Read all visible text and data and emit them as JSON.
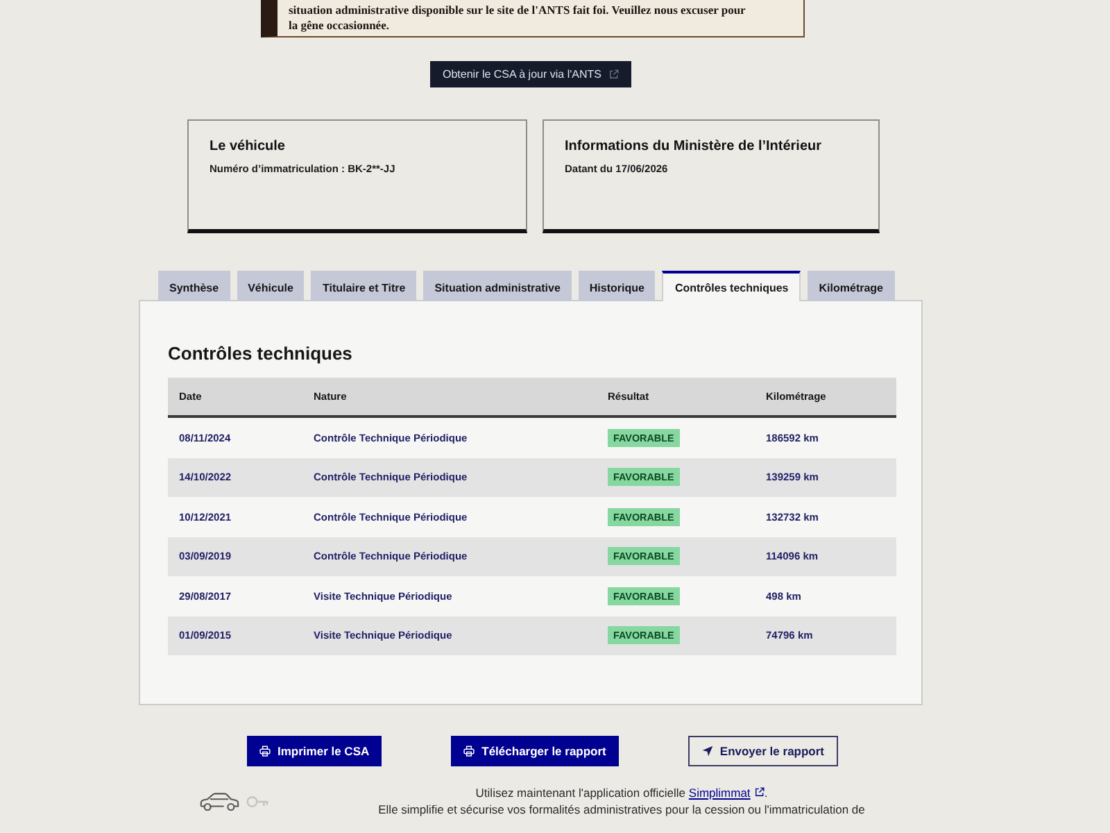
{
  "alert": {
    "text": "situation administrative disponible sur le site de l'ANTS fait foi. Veuillez nous excuser pour la gêne occasionnée."
  },
  "ants_button": {
    "label": "Obtenir le CSA à jour via l'ANTS"
  },
  "cards": [
    {
      "title": "Le véhicule",
      "text": "Numéro d’immatriculation : BK-2**-JJ"
    },
    {
      "title": "Informations du Ministère de l’Intérieur",
      "text": "Datant du 17/06/2026"
    }
  ],
  "tabs": [
    {
      "label": "Synthèse",
      "selected": false
    },
    {
      "label": "Véhicule",
      "selected": false
    },
    {
      "label": "Titulaire et Titre",
      "selected": false
    },
    {
      "label": "Situation administrative",
      "selected": false
    },
    {
      "label": "Historique",
      "selected": false
    },
    {
      "label": "Contrôles techniques",
      "selected": true
    },
    {
      "label": "Kilométrage",
      "selected": false
    }
  ],
  "panel": {
    "title": "Contrôles techniques",
    "columns": [
      "Date",
      "Nature",
      "Résultat",
      "Kilométrage"
    ],
    "rows": [
      {
        "date": "08/11/2024",
        "nature": "Contrôle Technique Périodique",
        "result": "FAVORABLE",
        "mileage": "186592 km"
      },
      {
        "date": "14/10/2022",
        "nature": "Contrôle Technique Périodique",
        "result": "FAVORABLE",
        "mileage": "139259 km"
      },
      {
        "date": "10/12/2021",
        "nature": "Contrôle Technique Périodique",
        "result": "FAVORABLE",
        "mileage": "132732 km"
      },
      {
        "date": "03/09/2019",
        "nature": "Contrôle Technique Périodique",
        "result": "FAVORABLE",
        "mileage": "114096 km"
      },
      {
        "date": "29/08/2017",
        "nature": "Visite Technique Périodique",
        "result": "FAVORABLE",
        "mileage": "498 km"
      },
      {
        "date": "01/09/2015",
        "nature": "Visite Technique Périodique",
        "result": "FAVORABLE",
        "mileage": "74796 km"
      }
    ]
  },
  "actions": [
    {
      "label": "Imprimer le CSA",
      "kind": "primary"
    },
    {
      "label": "Télécharger le rapport",
      "kind": "primary"
    },
    {
      "label": "Envoyer le rapport",
      "kind": "secondary"
    }
  ],
  "footer": {
    "before": "Utilisez maintenant l'application officielle ",
    "link": "Simplimmat",
    "after": ".",
    "line_2": "Elle simplifie et sécurise vos formalités administratives pour la cession ou l'immatriculation de"
  }
}
